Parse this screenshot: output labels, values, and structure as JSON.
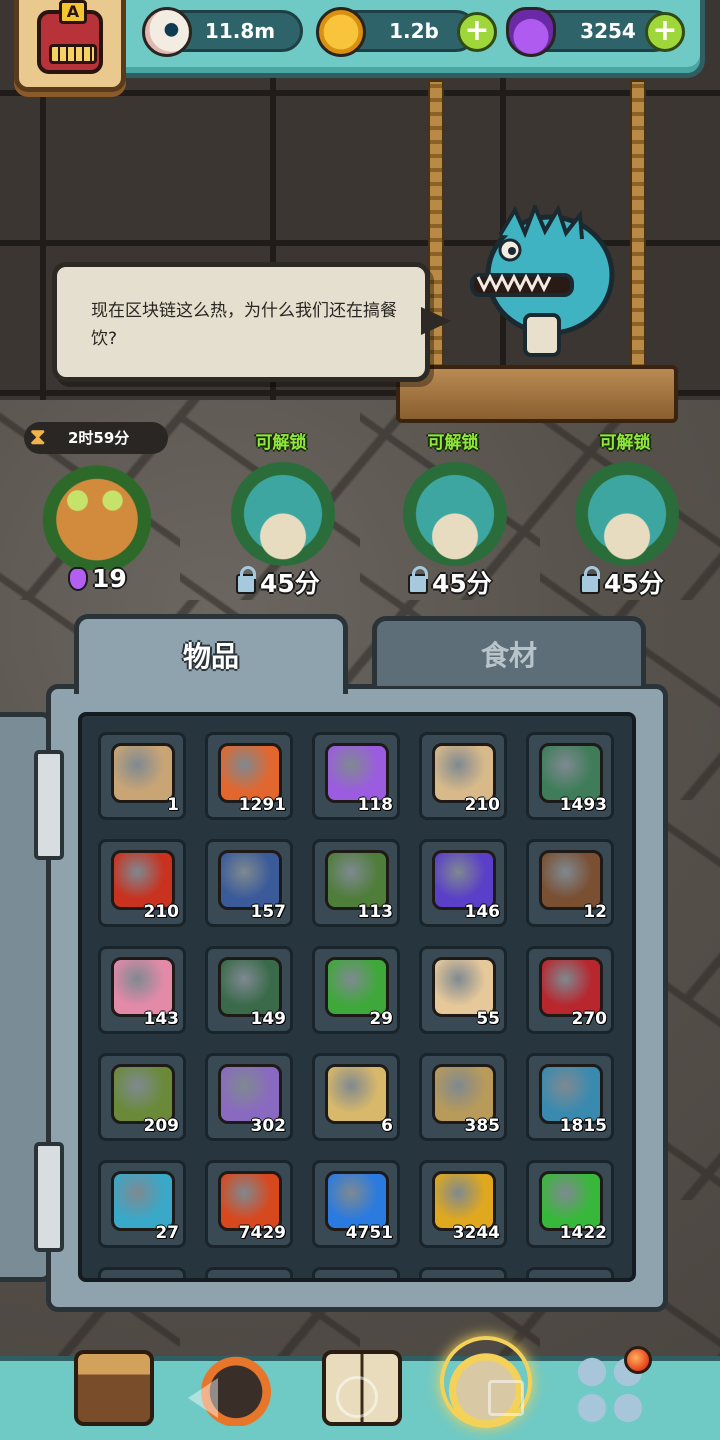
{
  "resources": {
    "eyes": "11.8m",
    "coins": "1.2b",
    "potions": "3254",
    "add_symbol": "+"
  },
  "avatar": {
    "rank": "A"
  },
  "dialogue": {
    "text": "现在区块链这么热，为什么我们还在搞餐饮?"
  },
  "customers": {
    "timer": "2时59分",
    "hourglass": "⧗",
    "slots": [
      {
        "label": "",
        "cost": "19",
        "icon": "potion-icon"
      },
      {
        "label": "可解锁",
        "cost": "45分",
        "icon": "lock-icon"
      },
      {
        "label": "可解锁",
        "cost": "45分",
        "icon": "lock-icon"
      },
      {
        "label": "可解锁",
        "cost": "45分",
        "icon": "lock-icon"
      }
    ]
  },
  "tabs": {
    "items": "物品",
    "ingredients": "食材"
  },
  "inventory": [
    {
      "name": "map-scrap-icon",
      "count": "1",
      "color": "#c9a576"
    },
    {
      "name": "meat-bone-icon",
      "count": "1291",
      "color": "#e2672e"
    },
    {
      "name": "purple-powder-icon",
      "count": "118",
      "color": "#9b5ce0"
    },
    {
      "name": "parchment-icon",
      "count": "210",
      "color": "#d8b98a"
    },
    {
      "name": "green-card-icon",
      "count": "1493",
      "color": "#3f7d5a"
    },
    {
      "name": "red-barrel-icon",
      "count": "210",
      "color": "#c8321f"
    },
    {
      "name": "blue-card-icon",
      "count": "157",
      "color": "#3a5a9a"
    },
    {
      "name": "green-scroll-icon",
      "count": "113",
      "color": "#4f7d3a"
    },
    {
      "name": "crystal-cluster-icon",
      "count": "146",
      "color": "#5a3fc8"
    },
    {
      "name": "rock-plant-icon",
      "count": "12",
      "color": "#7a4f32"
    },
    {
      "name": "pink-book-icon",
      "count": "143",
      "color": "#e28aa8"
    },
    {
      "name": "stained-glass-icon",
      "count": "149",
      "color": "#3a6a4a"
    },
    {
      "name": "four-leaf-clover-icon",
      "count": "29",
      "color": "#3fa83a"
    },
    {
      "name": "bunny-cake-icon",
      "count": "55",
      "color": "#e6c89a"
    },
    {
      "name": "santa-hat-icon",
      "count": "270",
      "color": "#b8262e"
    },
    {
      "name": "zongzi-icon",
      "count": "209",
      "color": "#6a8a3a"
    },
    {
      "name": "treasure-box-icon",
      "count": "302",
      "color": "#8a6ac0"
    },
    {
      "name": "gold-coin-pile-icon",
      "count": "6",
      "color": "#d8b86a"
    },
    {
      "name": "dark-creature-icon",
      "count": "385",
      "color": "#b89a5a"
    },
    {
      "name": "blob-portrait-icon",
      "count": "1815",
      "color": "#3a8ab0"
    },
    {
      "name": "blue-slime-icon",
      "count": "27",
      "color": "#3aa8c8"
    },
    {
      "name": "red-triangle-gem-icon",
      "count": "7429",
      "color": "#d8481e"
    },
    {
      "name": "blue-square-gem-icon",
      "count": "4751",
      "color": "#2a7ae0"
    },
    {
      "name": "yellow-pentagon-gem-icon",
      "count": "3244",
      "color": "#e0a81e"
    },
    {
      "name": "green-hexagon-gem-icon",
      "count": "1422",
      "color": "#38b83a"
    }
  ],
  "nav": {
    "shop": "shop-icon",
    "monster": "monster-icon",
    "book": "recipe-book-icon",
    "bag": "inventory-bag-icon",
    "menu": "menu-grid-icon"
  }
}
